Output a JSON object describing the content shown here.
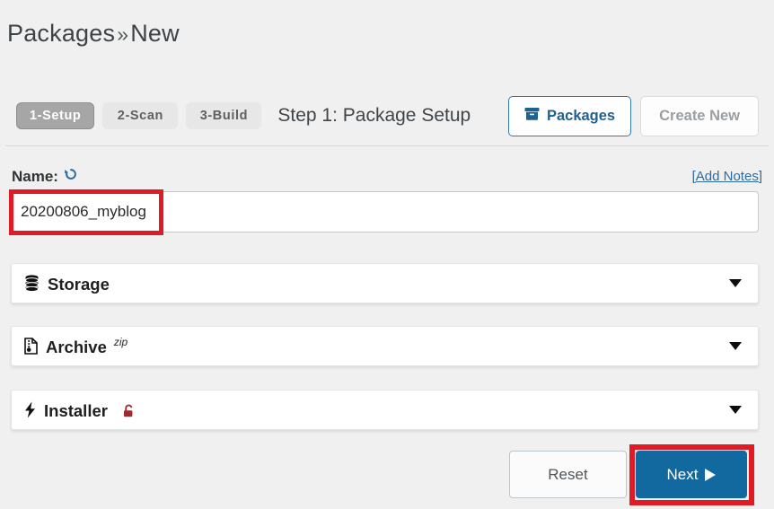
{
  "page": {
    "title_main": "Packages",
    "title_separator": "»",
    "title_sub": "New"
  },
  "stepbar": {
    "tabs": [
      {
        "label": "1-Setup",
        "active": true
      },
      {
        "label": "2-Scan",
        "active": false
      },
      {
        "label": "3-Build",
        "active": false
      }
    ],
    "step_title": "Step 1: Package Setup"
  },
  "header_actions": {
    "packages_label": "Packages",
    "packages_icon": "archive-box-icon",
    "create_new_label": "Create New",
    "create_new_disabled": true
  },
  "name_section": {
    "label": "Name:",
    "refresh_icon": "undo-refresh-icon",
    "add_notes_label": "[Add Notes]",
    "input_value": "20200806_myblog",
    "input_placeholder": ""
  },
  "panels": [
    {
      "id": "storage",
      "label": "Storage",
      "icon": "database-icon",
      "superscript": "",
      "badge_icon": "",
      "caret_icon": "chevron-down-icon"
    },
    {
      "id": "archive",
      "label": "Archive",
      "icon": "file-archive-icon",
      "superscript": "zip",
      "badge_icon": "",
      "caret_icon": "chevron-down-icon"
    },
    {
      "id": "installer",
      "label": "Installer",
      "icon": "lightning-bolt-icon",
      "superscript": "",
      "badge_icon": "unlocked-padlock-icon",
      "caret_icon": "chevron-down-icon"
    }
  ],
  "footer": {
    "reset_label": "Reset",
    "next_label": "Next",
    "next_icon": "play-triangle-icon"
  },
  "colors": {
    "page_background": "#f0f0f0",
    "accent_blue": "#11699f",
    "link_blue": "#2c6ca3",
    "annotation_red": "#e01b24",
    "active_tab_gray": "#a6a6a6",
    "lock_red": "#9e2a2b"
  }
}
